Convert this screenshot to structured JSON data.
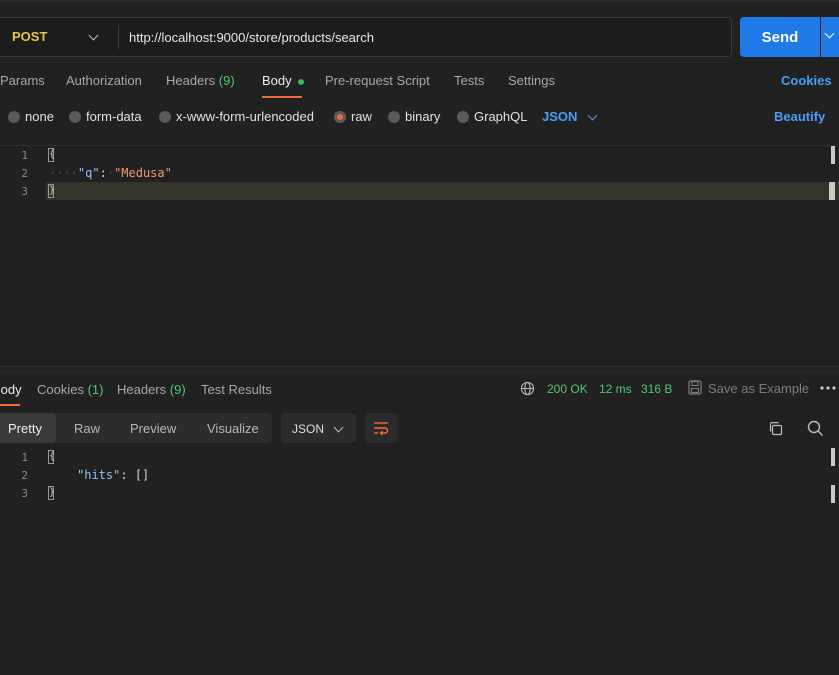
{
  "request": {
    "method": "POST",
    "url": "http://localhost:9000/store/products/search",
    "send_label": "Send"
  },
  "request_tabs": [
    {
      "label": "Params"
    },
    {
      "label": "Authorization"
    },
    {
      "label": "Headers",
      "count": "(9)"
    },
    {
      "label": "Body"
    },
    {
      "label": "Pre-request Script"
    },
    {
      "label": "Tests"
    },
    {
      "label": "Settings"
    }
  ],
  "cookies_link": "Cookies",
  "body_types": [
    "none",
    "form-data",
    "x-www-form-urlencoded",
    "raw",
    "binary",
    "GraphQL"
  ],
  "body_format": "JSON",
  "beautify_label": "Beautify",
  "request_editor": {
    "line_numbers": [
      "1",
      "2",
      "3"
    ],
    "open_brace": "{",
    "key": "\"q\"",
    "colon": ":",
    "value": "\"Medusa\"",
    "close_brace": "}"
  },
  "response_tabs": [
    {
      "label": "Body"
    },
    {
      "label": "Cookies",
      "count": "(1)"
    },
    {
      "label": "Headers",
      "count": "(9)"
    },
    {
      "label": "Test Results"
    }
  ],
  "response_status": {
    "code": "200 OK",
    "time": "12 ms",
    "size": "316 B"
  },
  "save_example_label": "Save as Example",
  "view_modes": [
    "Pretty",
    "Raw",
    "Preview",
    "Visualize"
  ],
  "response_format": "JSON",
  "response_editor": {
    "line_numbers": [
      "1",
      "2",
      "3"
    ],
    "open_brace": "{",
    "key": "\"hits\"",
    "colon": ":",
    "value": "[]",
    "close_brace": "}"
  },
  "colors": {
    "accent": "#f26b3a",
    "link": "#4a9df8",
    "send": "#1f7ae8",
    "success": "#4ec96b",
    "method": "#e8c44a"
  }
}
